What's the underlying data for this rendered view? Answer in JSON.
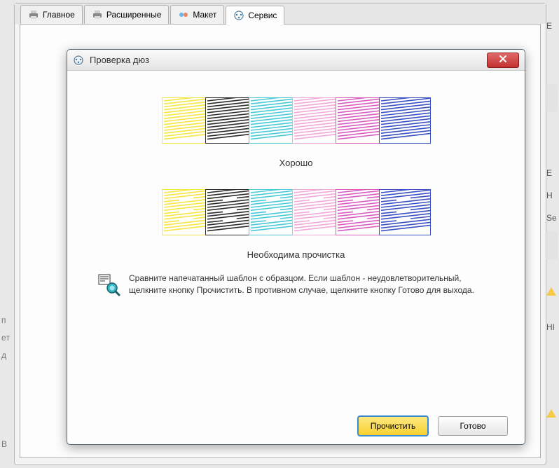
{
  "tabs": [
    {
      "label": "Главное"
    },
    {
      "label": "Расширенные"
    },
    {
      "label": "Макет"
    },
    {
      "label": "Сервис"
    }
  ],
  "active_tab_index": 3,
  "dialog": {
    "title": "Проверка дюз",
    "good_label": "Хорошо",
    "bad_label": "Необходима прочистка",
    "instruction": "Сравните напечатанный шаблон с образцом. Если шаблон - неудовлетворительный, щелкните кнопку Прочистить. В противном случае, щелкните кнопку Готово для выхода.",
    "clean_button": "Прочистить",
    "done_button": "Готово",
    "colors": {
      "yellow": "#f5e642",
      "black": "#2c2c2c",
      "cyan": "#49c9d6",
      "lightmagenta": "#f2a8d8",
      "magenta": "#d95bc0",
      "blue": "#3a4fc2"
    }
  },
  "partial": {
    "right_chars": [
      "E",
      "E",
      "H",
      "Se",
      "HI"
    ],
    "left_chars": [
      "п",
      "eт",
      "д"
    ],
    "bottom_left": "B"
  }
}
